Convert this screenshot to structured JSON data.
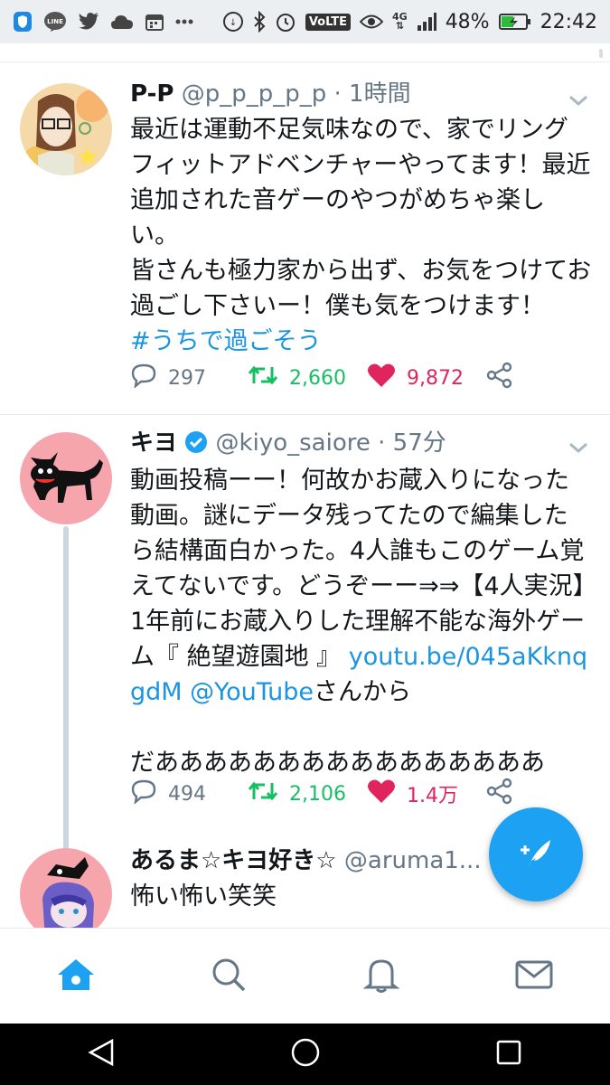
{
  "status_bar": {
    "left_icons": [
      "shield-icon",
      "line-icon",
      "twitter-icon",
      "cloud-icon",
      "calendar-icon",
      "more-icon"
    ],
    "right_icons": [
      "data-saver-icon",
      "bluetooth-icon",
      "alarm-icon",
      "volte-badge",
      "eye-icon",
      "network-4g-icon",
      "signal-icon"
    ],
    "volte": "VoLTE",
    "net": "4G",
    "battery": "48%",
    "time": "22:42"
  },
  "tweets": [
    {
      "name": "P-P",
      "handle": "@p_p_p_p_p",
      "sep": " · ",
      "time": "1時間",
      "body": "最近は運動不足気味なので、家でリングフィットアドベンチャーやってます！最近追加された音ゲーのやつがめちゃ楽しい。\n皆さんも極力家から出ず、お気をつけてお過ごし下さいー！僕も気をつけます！",
      "hashtag": "#うちで過ごそう",
      "replies": "297",
      "retweets": "2,660",
      "likes": "9,872",
      "liked": true
    },
    {
      "name": "キヨ",
      "verified": true,
      "handle": "@kiyo_saiore",
      "sep": " · ",
      "time": "57分",
      "body_before_link": "動画投稿ーー！何故かお蔵入りになった動画。謎にデータ残ってたので編集したら結構面白かった。4人誰もこのゲーム覚えてないです。どうぞーー⇒⇒【4人実況】1年前にお蔵入りした理解不能な海外ゲーム『 絶望遊園地 』 ",
      "link": "youtu.be/045aKknqgdM",
      "mention": "@YouTube",
      "body_after_link": "さんから",
      "body_tail": "だああああああああああああああああ",
      "replies": "494",
      "retweets": "2,106",
      "likes": "1.4万",
      "liked": true
    },
    {
      "name": "あるま☆キヨ好き☆",
      "handle": "@aruma1...",
      "body": "怖い怖い笑笑"
    }
  ],
  "compose_button": "compose-tweet-icon",
  "tabs": [
    "home-icon",
    "search-icon",
    "notifications-icon",
    "messages-icon"
  ],
  "nav": [
    "back-icon",
    "home-circle-icon",
    "recents-icon"
  ],
  "colors": {
    "accent": "#1da1f2",
    "link": "#1b95e0",
    "retweet": "#17bf63",
    "like": "#e0245e",
    "muted": "#657786"
  }
}
